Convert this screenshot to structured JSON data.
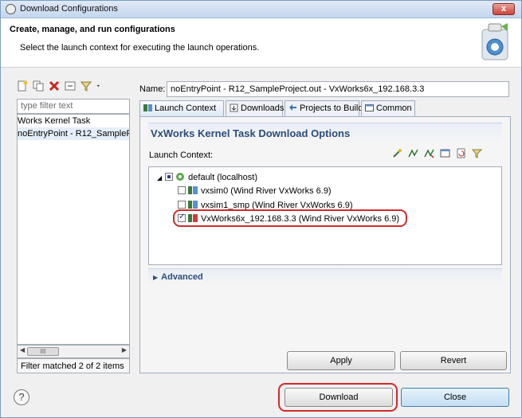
{
  "window": {
    "title": "Download Configurations",
    "close": "x"
  },
  "header": {
    "title": "Create, manage, and run configurations",
    "subtitle": "Select the launch context for executing the launch operations."
  },
  "left": {
    "filter_placeholder": "type filter text",
    "tree": [
      "Works Kernel Task",
      "noEntryPoint - R12_SampleP"
    ],
    "scroll_label": "III",
    "status": "Filter matched 2 of 2 items"
  },
  "right": {
    "name_label": "Name:",
    "name_value": "noEntryPoint - R12_SampleProject.out - VxWorks6x_192.168.3.3",
    "tabs": [
      "Launch Context",
      "Downloads",
      "Projects to Build",
      "Common"
    ],
    "section_title": "VxWorks Kernel Task Download Options",
    "launch_context_label": "Launch Context:",
    "tree": {
      "root": "default (localhost)",
      "items": [
        "vxsim0 (Wind River VxWorks 6.9)",
        "vxsim1_smp (Wind River VxWorks 6.9)",
        "VxWorks6x_192.168.3.3 (Wind River VxWorks 6.9)"
      ]
    },
    "advanced": "Advanced",
    "apply": "Apply",
    "revert": "Revert"
  },
  "footer": {
    "help": "?",
    "download": "Download",
    "close": "Close"
  },
  "colors": {
    "highlight": "#d12a2a",
    "section_text": "#2c4c79"
  }
}
